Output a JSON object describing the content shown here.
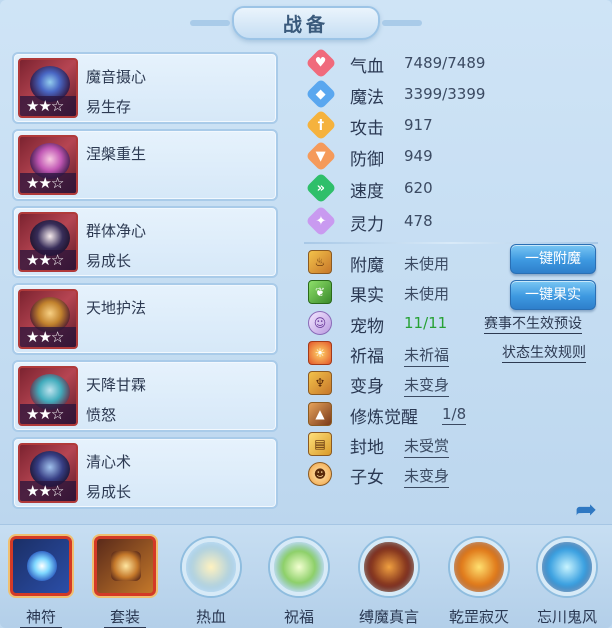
{
  "title": "战备",
  "skills": [
    {
      "name": "魔音摄心",
      "sub": "易生存",
      "stars": "★★☆"
    },
    {
      "name": "涅槃重生",
      "sub": "",
      "stars": "★★☆"
    },
    {
      "name": "群体净心",
      "sub": "易成长",
      "stars": "★★☆"
    },
    {
      "name": "天地护法",
      "sub": "",
      "stars": "★★☆"
    },
    {
      "name": "天降甘霖",
      "sub": "愤怒",
      "stars": "★★☆"
    },
    {
      "name": "清心术",
      "sub": "易成长",
      "stars": "★★☆"
    }
  ],
  "stats": [
    {
      "label": "气血",
      "value": "7489/7489",
      "icon": "heart-icon",
      "color": "#f06a7c"
    },
    {
      "label": "魔法",
      "value": "3399/3399",
      "icon": "magic-icon",
      "color": "#5aa7ef"
    },
    {
      "label": "攻击",
      "value": "917",
      "icon": "attack-icon",
      "color": "#f5b23d"
    },
    {
      "label": "防御",
      "value": "949",
      "icon": "defense-icon",
      "color": "#f59a5a"
    },
    {
      "label": "速度",
      "value": "620",
      "icon": "speed-icon",
      "color": "#2fbf6a"
    },
    {
      "label": "灵力",
      "value": "478",
      "icon": "spirit-icon",
      "color": "#c99af0"
    }
  ],
  "items": [
    {
      "label": "附魔",
      "value": "未使用",
      "icon": "enchant-icon"
    },
    {
      "label": "果实",
      "value": "未使用",
      "icon": "fruit-icon"
    },
    {
      "label": "宠物",
      "value": "11/11",
      "icon": "pet-icon"
    },
    {
      "label": "祈福",
      "value": "未祈福",
      "icon": "blessing-icon"
    },
    {
      "label": "变身",
      "value": "未变身",
      "icon": "transform-icon"
    },
    {
      "label": "修炼觉醒",
      "value": "1/8",
      "icon": "cultivation-icon"
    },
    {
      "label": "封地",
      "value": "未受赏",
      "icon": "fief-icon"
    },
    {
      "label": "子女",
      "value": "未变身",
      "icon": "child-icon"
    }
  ],
  "buttons": {
    "enchant": "一键附魔",
    "fruit": "一键果实"
  },
  "links": {
    "preset": "赛事不生效预设",
    "rules": "状态生效规则"
  },
  "tabs": [
    {
      "label": "神符",
      "icon": "rune-icon"
    },
    {
      "label": "套装",
      "icon": "set-icon"
    },
    {
      "label": "热血",
      "icon": "passion-icon"
    },
    {
      "label": "祝福",
      "icon": "bless-icon"
    },
    {
      "label": "缚魔真言",
      "icon": "bind-demon-icon"
    },
    {
      "label": "乾罡寂灭",
      "icon": "qiangang-icon"
    },
    {
      "label": "忘川鬼风",
      "icon": "wangchuan-icon"
    }
  ]
}
